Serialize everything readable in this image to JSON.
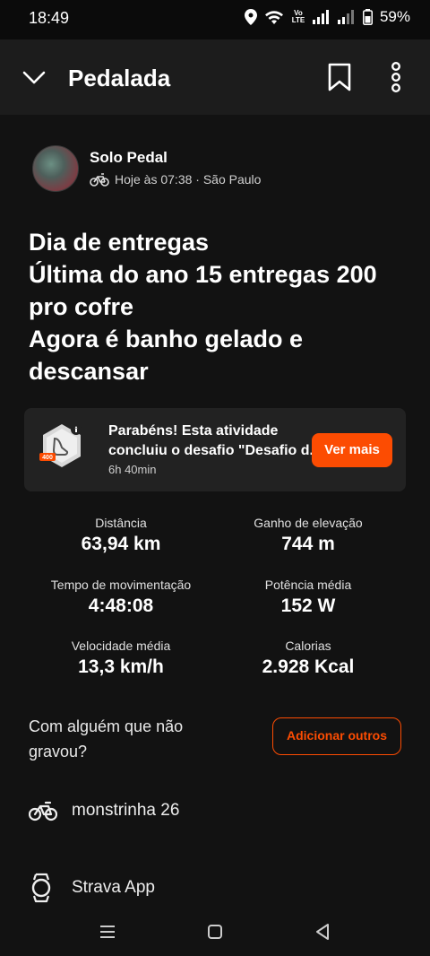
{
  "status_bar": {
    "time": "18:49",
    "battery": "59%",
    "volte": "Vo LTE"
  },
  "app_bar": {
    "title": "Pedalada"
  },
  "athlete": {
    "name": "Solo Pedal",
    "meta": "Hoje às 07:38 · São Paulo"
  },
  "activity": {
    "title_lines": [
      "Dia de entregas",
      "Última do ano 15 entregas 200",
      "pro cofre",
      "Agora é banho gelado e",
      "descansar"
    ]
  },
  "challenge": {
    "line1": "Parabéns! Esta atividade",
    "line2": "concluiu o desafio \"Desafio d...",
    "duration": "6h 40min",
    "button": "Ver mais",
    "badge_text": "400"
  },
  "stats": [
    {
      "label": "Distância",
      "value": "63,94 km"
    },
    {
      "label": "Ganho de elevação",
      "value": "744 m"
    },
    {
      "label": "Tempo de movimentação",
      "value": "4:48:08"
    },
    {
      "label": "Potência média",
      "value": "152 W"
    },
    {
      "label": "Velocidade média",
      "value": "13,3 km/h"
    },
    {
      "label": "Calorias",
      "value": "2.928 Kcal"
    }
  ],
  "group": {
    "question": "Com alguém que não gravou?",
    "button": "Adicionar outros"
  },
  "gear": {
    "name": "monstrinha 26",
    "icon": "bike-icon"
  },
  "device": {
    "name": "Strava App",
    "icon": "watch-icon"
  },
  "colors": {
    "accent": "#fc4c02",
    "background": "#121212",
    "card": "#222222"
  }
}
